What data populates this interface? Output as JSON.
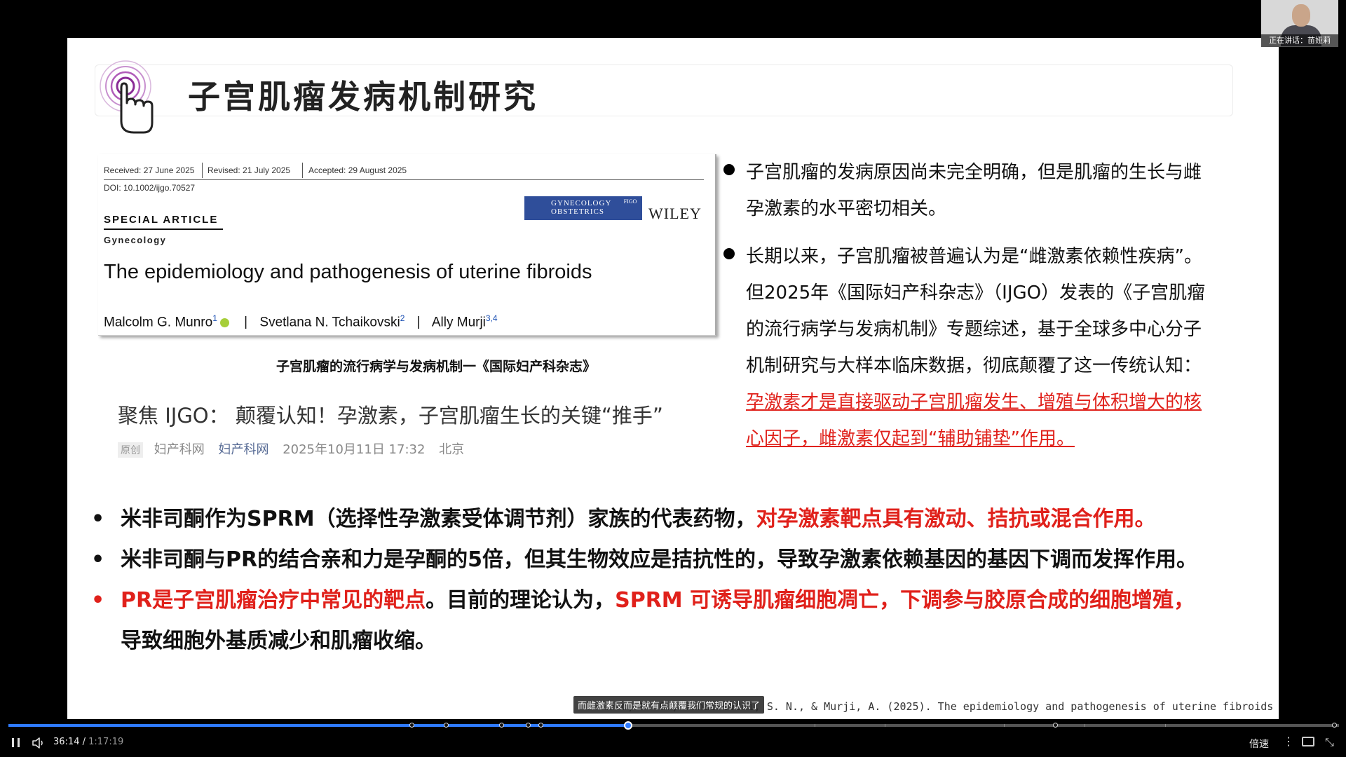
{
  "slide": {
    "title": "子宫肌瘤发病机制研究",
    "paper": {
      "received": "Received: 27 June 2025",
      "revised": "Revised: 21 July 2025",
      "accepted": "Accepted: 29 August 2025",
      "doi": "DOI: 10.1002/ijgo.70527",
      "section": "SPECIAL ARTICLE",
      "category": "Gynecology",
      "journal_logo": "GYNECOLOGY OBSTETRICS",
      "journal_logo_mark": "FIGO",
      "publisher": "WILEY",
      "title": "The epidemiology and pathogenesis of uterine fibroids",
      "authors": [
        {
          "name": "Malcolm G. Munro",
          "sup": "1"
        },
        {
          "name": "Svetlana N. Tchaikovski",
          "sup": "2"
        },
        {
          "name": "Ally Murji",
          "sup": "3,4"
        }
      ],
      "author_separator": "|"
    },
    "caption": "子宫肌瘤的流行病学与发病机制一《国际妇产科杂志》",
    "news": {
      "title": "聚焦 IJGO： 颠覆认知！孕激素，子宫肌瘤生长的关键“推手”",
      "badge": "原创",
      "source": "妇产科网",
      "source_link": "妇产科网",
      "datetime": "2025年10月11日 17:32",
      "location": "北京"
    },
    "right_bullets": [
      {
        "lines": [
          "子宫肌瘤的发病原因尚未完全明确，但是肌瘤的生长与雌",
          "孕激素的水平密切相关。"
        ]
      },
      {
        "lines": [
          "长期以来，子宫肌瘤被普遍认为是“雌激素依赖性疾病”。",
          "但2025年《国际妇产科杂志》（IJGO）发表的《子宫肌瘤",
          "的流行病学与发病机制》专题综述，基于全球多中心分子",
          "机制研究与大样本临床数据，彻底颠覆了这一传统认知："
        ],
        "highlight_lines": [
          "孕激素才是直接驱动子宫肌瘤发生、增殖与体积增大的核",
          "心因子，雌激素仅起到“辅助铺垫”作用。"
        ]
      }
    ],
    "bottom_bullets": {
      "b1_black": "米非司酮作为SPRM（选择性孕激素受体调节剂）家族的代表药物，",
      "b1_red": "对孕激素靶点具有激动、拮抗或混合作用。",
      "b2_black": "米非司酮与PR的结合亲和力是孕酮的5倍，但其生物效应是拮抗性的，导致孕激素依赖基因的基因下调而发挥作用。",
      "b3_red_a": "PR是子宫肌瘤治疗中常见的靶点",
      "b3_black": "。目前的理论认为，",
      "b3_red_b": "SPRM 可诱导肌瘤细胞凋亡，下调参与胶原合成的细胞增殖，",
      "b3_red_c": "导致细胞外基质减少和肌瘤收缩。",
      "bullet_char": "•"
    },
    "citation": "Munro, M. G., Tchaikovski, S. N., & Murji, A. (2025). The epidemiology and pathogenesis of uterine fibroids",
    "subtitle": "而雌激素反而是就有点颠覆我们常规的认识了"
  },
  "speaker": {
    "label": "正在讲话：苗娅莉"
  },
  "player": {
    "current_time": "36:14 /",
    "total_time": "1:17:19",
    "progress": 0.4655,
    "speed_label": "倍速",
    "more_icon": "more-icon",
    "accent": "#2f7bff"
  },
  "colors": {
    "highlight_red": "#e0211b",
    "slide_background": "#ffffff",
    "page_background": "#000000"
  }
}
